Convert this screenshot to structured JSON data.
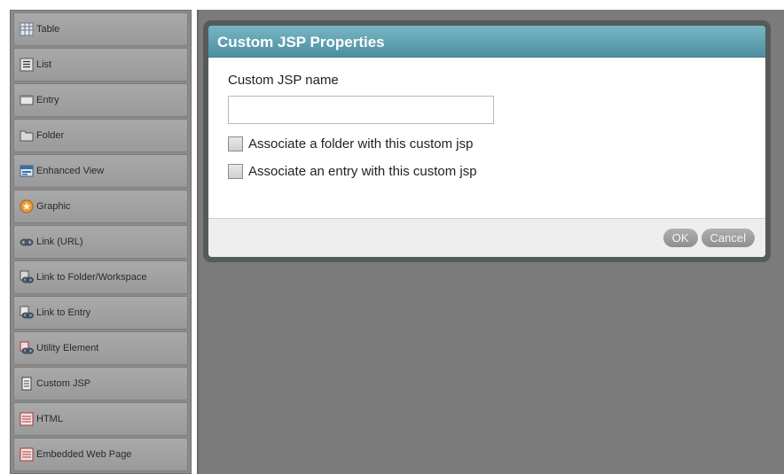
{
  "palette": {
    "items": [
      {
        "label": "Table",
        "icon": "table-icon"
      },
      {
        "label": "List",
        "icon": "list-icon"
      },
      {
        "label": "Entry",
        "icon": "entry-icon"
      },
      {
        "label": "Folder",
        "icon": "folder-icon"
      },
      {
        "label": "Enhanced View",
        "icon": "enhanced-view-icon"
      },
      {
        "label": "Graphic",
        "icon": "graphic-icon"
      },
      {
        "label": "Link (URL)",
        "icon": "link-url-icon"
      },
      {
        "label": "Link to Folder/Workspace",
        "icon": "link-folder-icon"
      },
      {
        "label": "Link to Entry",
        "icon": "link-entry-icon"
      },
      {
        "label": "Utility Element",
        "icon": "utility-element-icon"
      },
      {
        "label": "Custom JSP",
        "icon": "custom-jsp-icon"
      },
      {
        "label": "HTML",
        "icon": "html-icon"
      },
      {
        "label": "Embedded Web Page",
        "icon": "embedded-web-page-icon"
      }
    ]
  },
  "dialog": {
    "title": "Custom JSP Properties",
    "jsp_name_label": "Custom JSP name",
    "jsp_name_value": "",
    "jsp_name_placeholder": "",
    "checkbox_folder_label": "Associate a folder with this custom jsp",
    "checkbox_folder_checked": false,
    "checkbox_entry_label": "Associate an entry with this custom jsp",
    "checkbox_entry_checked": false,
    "ok_label": "OK",
    "cancel_label": "Cancel"
  },
  "colors": {
    "title_bar": "#5a9dae",
    "dialog_frame": "#555a5c",
    "canvas": "#7b7b7b",
    "palette_item": "#a3a3a3"
  }
}
